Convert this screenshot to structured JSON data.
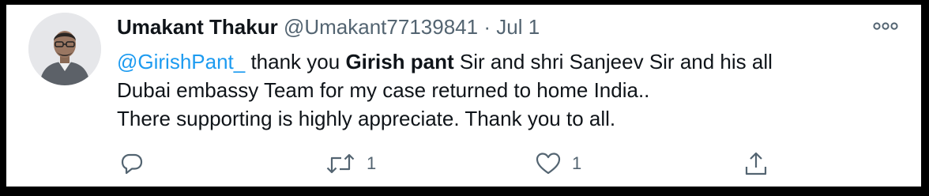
{
  "tweet": {
    "display_name": "Umakant Thakur",
    "handle": "@Umakant77139841",
    "separator": "·",
    "date": "Jul 1",
    "text": {
      "mention": "@GirishPant_",
      "part1": " thank you ",
      "bold_name": "Girish pant",
      "part2": " Sir and shri Sanjeev Sir and his all",
      "line2": "Dubai embassy Team for my case returned to home India..",
      "line3": "There supporting is highly appreciate. Thank you to all."
    },
    "actions": {
      "reply_icon": "reply-icon",
      "retweet_icon": "retweet-icon",
      "retweet_count": "1",
      "like_icon": "heart-icon",
      "like_count": "1",
      "share_icon": "share-icon"
    },
    "colors": {
      "mention": "#1d9bf0",
      "secondary_text": "#536471",
      "primary_text": "#0f1419"
    }
  }
}
